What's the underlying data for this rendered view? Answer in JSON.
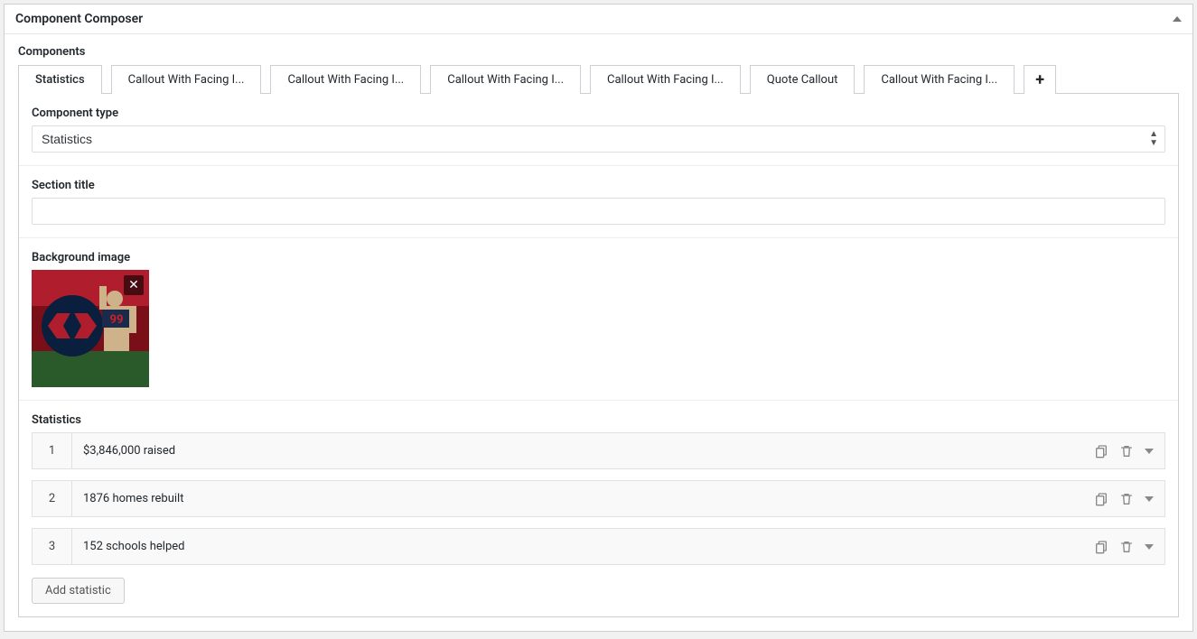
{
  "metabox": {
    "title": "Component Composer"
  },
  "components_label": "Components",
  "tabs": [
    {
      "label": "Statistics",
      "active": true
    },
    {
      "label": "Callout With Facing I...",
      "active": false
    },
    {
      "label": "Callout With Facing I...",
      "active": false
    },
    {
      "label": "Callout With Facing I...",
      "active": false
    },
    {
      "label": "Callout With Facing I...",
      "active": false
    },
    {
      "label": "Quote Callout",
      "active": false
    },
    {
      "label": "Callout With Facing I...",
      "active": false
    }
  ],
  "fields": {
    "component_type": {
      "label": "Component type",
      "value": "Statistics"
    },
    "section_title": {
      "label": "Section title",
      "value": ""
    },
    "background_image": {
      "label": "Background image"
    },
    "statistics": {
      "label": "Statistics",
      "rows": [
        {
          "index": "1",
          "text": "$3,846,000 raised"
        },
        {
          "index": "2",
          "text": "1876 homes rebuilt"
        },
        {
          "index": "3",
          "text": "152 schools helped"
        }
      ],
      "add_label": "Add statistic"
    }
  }
}
